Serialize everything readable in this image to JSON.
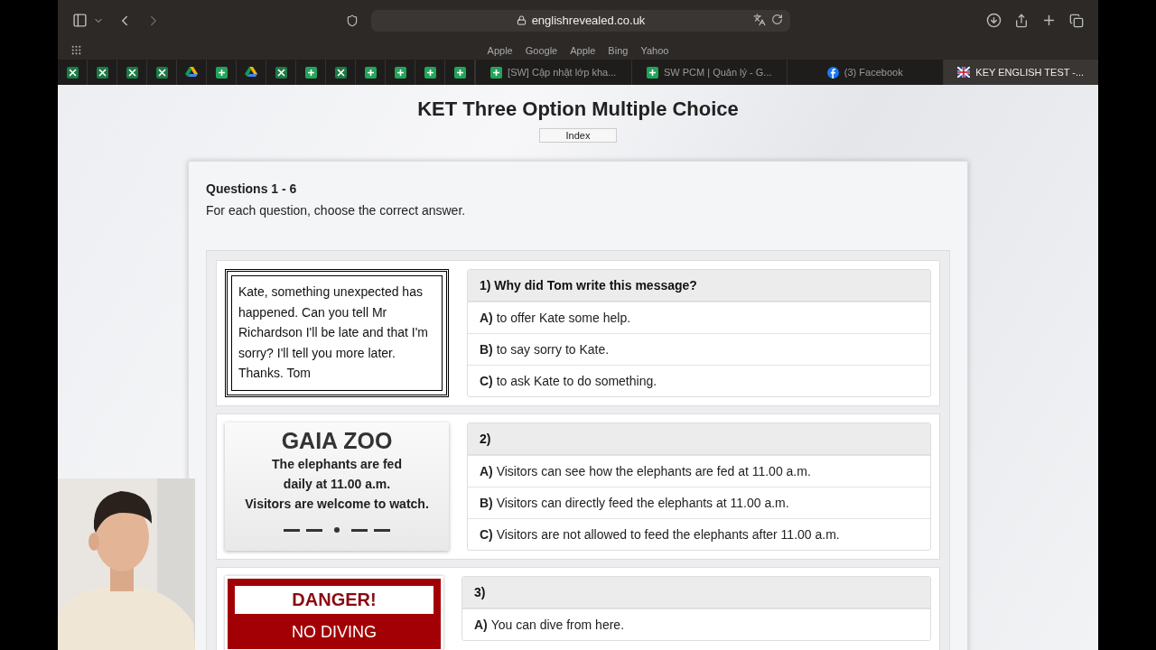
{
  "browser": {
    "address": "englishrevealed.co.uk",
    "bookmarks": [
      "Apple",
      "Google",
      "Apple",
      "Bing",
      "Yahoo"
    ],
    "pinned_tabs": [
      {
        "kind": "excel",
        "selected": false
      },
      {
        "kind": "excel",
        "selected": false
      },
      {
        "kind": "excel",
        "selected": false
      },
      {
        "kind": "excel",
        "selected": false
      },
      {
        "kind": "drive",
        "selected": false
      },
      {
        "kind": "sheets",
        "selected": false
      },
      {
        "kind": "drive",
        "selected": false
      },
      {
        "kind": "excel",
        "selected": false
      },
      {
        "kind": "sheets",
        "selected": false
      },
      {
        "kind": "excel",
        "selected": false
      },
      {
        "kind": "sheets",
        "selected": false
      },
      {
        "kind": "sheets",
        "selected": false
      },
      {
        "kind": "sheets",
        "selected": false
      },
      {
        "kind": "sheets",
        "selected": false
      }
    ],
    "tabs": [
      {
        "title": "[SW] Cập nhật lớp kha...",
        "kind": "sheets",
        "selected": false
      },
      {
        "title": "SW PCM | Quản lý - G...",
        "kind": "sheets",
        "selected": false
      },
      {
        "title": "(3) Facebook",
        "kind": "facebook",
        "selected": false
      },
      {
        "title": "KEY ENGLISH TEST -...",
        "kind": "flag",
        "selected": true
      }
    ]
  },
  "page": {
    "title": "KET Three Option Multiple Choice",
    "index_button": "Index",
    "heading": "Questions 1 - 6",
    "instruction": "For each question, choose the correct answer.",
    "questions": [
      {
        "sign": {
          "kind": "note",
          "text": "Kate, something unexpected has happened. Can you tell Mr Richardson I'll be late and that I'm sorry? I'll tell you more later. Thanks. Tom"
        },
        "prompt": "1) Why did Tom write this message?",
        "options": [
          {
            "letter": "A)",
            "text": "to offer Kate some help."
          },
          {
            "letter": "B)",
            "text": "to say sorry to Kate."
          },
          {
            "letter": "C)",
            "text": "to ask Kate to do something."
          }
        ]
      },
      {
        "sign": {
          "kind": "notice",
          "title": "GAIA ZOO",
          "lines": [
            "The elephants are fed",
            "daily at 11.00 a.m.",
            "Visitors are welcome to watch."
          ]
        },
        "prompt": "2)",
        "options": [
          {
            "letter": "A)",
            "text": "Visitors can see how the elephants are fed at 11.00 a.m."
          },
          {
            "letter": "B)",
            "text": "Visitors can directly feed the elephants at 11.00 a.m."
          },
          {
            "letter": "C)",
            "text": "Visitors are not allowed to feed the elephants after 11.00 a.m."
          }
        ]
      },
      {
        "sign": {
          "kind": "danger",
          "title": "DANGER!",
          "subtitle": "NO DIVING"
        },
        "prompt": "3)",
        "options": [
          {
            "letter": "A)",
            "text": "You can dive from here."
          }
        ]
      }
    ]
  }
}
